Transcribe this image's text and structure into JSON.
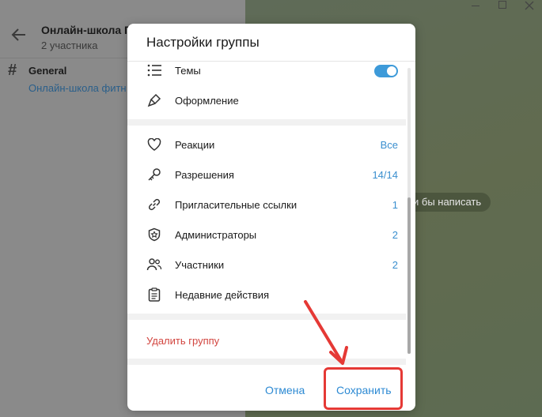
{
  "background": {
    "chat_title": "Онлайн-школа П",
    "chat_subtitle": "2 участника",
    "topic_name": "General",
    "topic_subtitle": "Онлайн-школа фитн",
    "hint_text": "и бы написать"
  },
  "dialog": {
    "title": "Настройки группы",
    "items": [
      {
        "label": "Темы",
        "icon": "list-icon",
        "value": "",
        "toggle": true
      },
      {
        "label": "Оформление",
        "icon": "brush-icon",
        "value": ""
      },
      {
        "label": "Реакции",
        "icon": "heart-icon",
        "value": "Все"
      },
      {
        "label": "Разрешения",
        "icon": "key-icon",
        "value": "14/14"
      },
      {
        "label": "Пригласительные ссылки",
        "icon": "link-icon",
        "value": "1"
      },
      {
        "label": "Администраторы",
        "icon": "admin-shield-icon",
        "value": "2"
      },
      {
        "label": "Участники",
        "icon": "people-icon",
        "value": "2"
      },
      {
        "label": "Недавние действия",
        "icon": "clipboard-icon",
        "value": ""
      }
    ],
    "delete_label": "Удалить группу",
    "cancel_label": "Отмена",
    "save_label": "Сохранить"
  },
  "colors": {
    "accent": "#3d9ad9",
    "danger": "#d2453f",
    "highlight": "#e53935"
  }
}
